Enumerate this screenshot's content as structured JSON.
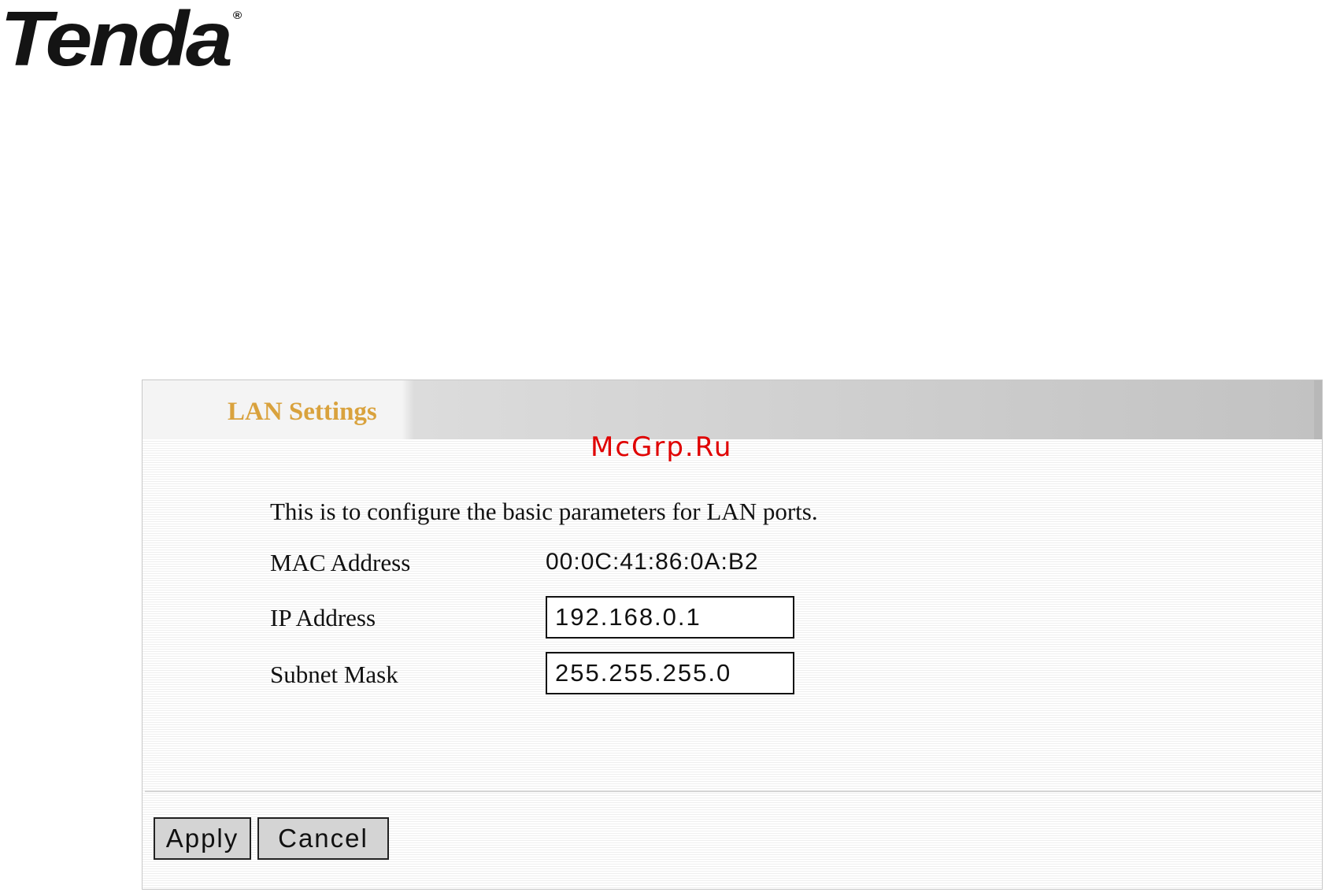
{
  "brand": {
    "logo_text": "Tenda",
    "logo_mark": "®"
  },
  "header": {
    "title": "LAN Settings"
  },
  "watermark": "McGrp.Ru",
  "description": "This is to configure the basic parameters for LAN ports.",
  "fields": {
    "mac": {
      "label": "MAC Address",
      "value": "00:0C:41:86:0A:B2"
    },
    "ip": {
      "label": "IP Address",
      "value": "192.168.0.1"
    },
    "subnet": {
      "label": "Subnet Mask",
      "value": "255.255.255.0"
    }
  },
  "buttons": {
    "apply": "Apply",
    "cancel": "Cancel"
  },
  "colors": {
    "title": "#d9a23d",
    "watermark": "#e00000",
    "button_bg": "#d4d4d4"
  }
}
